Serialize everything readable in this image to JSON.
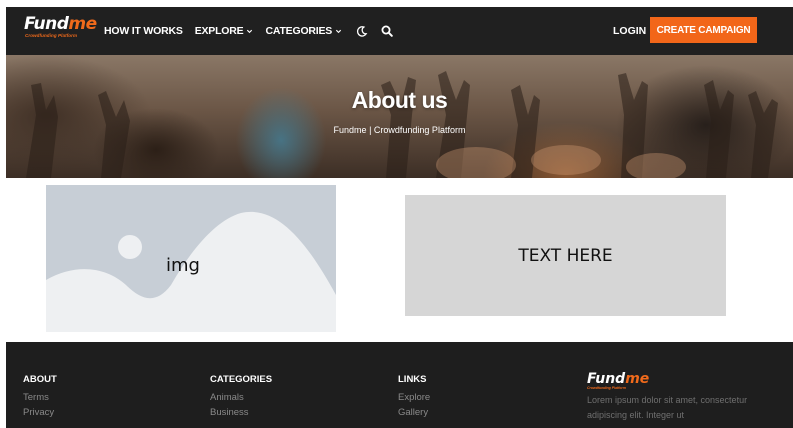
{
  "header": {
    "logo_main": "Fund",
    "logo_accent": "me",
    "logo_sub": "Crowdfunding Platform",
    "nav": {
      "how_it_works": "HOW IT WORKS",
      "explore": "EXPLORE",
      "categories": "CATEGORIES"
    },
    "icons": [
      "chevron-down-icon",
      "moon-icon",
      "search-icon"
    ],
    "login": "LOGIN",
    "cta": "CREATE CAMPAIGN"
  },
  "hero": {
    "title": "About us",
    "subtitle": "Fundme | Crowdfunding Platform"
  },
  "content": {
    "image_label": "img",
    "text_box": "TEXT HERE"
  },
  "footer": {
    "about": {
      "heading": "ABOUT",
      "links": [
        "Terms",
        "Privacy"
      ]
    },
    "categories": {
      "heading": "CATEGORIES",
      "links": [
        "Animals",
        "Business"
      ]
    },
    "links": {
      "heading": "LINKS",
      "links": [
        "Explore",
        "Gallery"
      ]
    },
    "brand": {
      "logo_main": "Fund",
      "logo_accent": "me",
      "logo_sub": "Crowdfunding Platform",
      "description": "Lorem ipsum dolor sit amet, consectetur adipiscing elit. Integer ut"
    }
  },
  "colors": {
    "header_bg": "#202020",
    "accent": "#f26619",
    "footer_bg": "#1e1e1e",
    "placeholder_bg": "#c7ced6",
    "text_box_bg": "#d6d6d6"
  }
}
